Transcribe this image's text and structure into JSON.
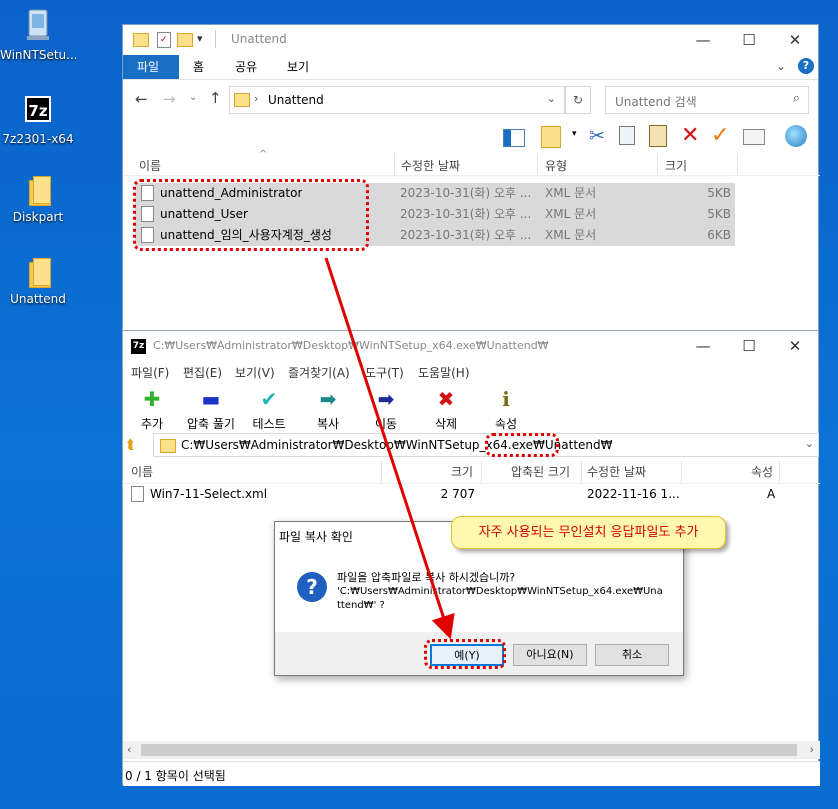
{
  "desktop": {
    "icons": [
      {
        "label": "WinNTSetu..."
      },
      {
        "label": "7z2301-x64"
      },
      {
        "label": "Diskpart"
      },
      {
        "label": "Unattend"
      }
    ]
  },
  "explorer": {
    "title": "Unattend",
    "quick_access_arrow": "▾",
    "ribbon_tabs": [
      "파일",
      "홈",
      "공유",
      "보기"
    ],
    "address": "Unattend",
    "search_placeholder": "Unattend 검색",
    "columns": {
      "name": "이름",
      "date": "수정한 날짜",
      "type": "유형",
      "size": "크기"
    },
    "files": [
      {
        "name": "unattend_Administrator",
        "date": "2023-10-31(화) 오후 ...",
        "type": "XML 문서",
        "size": "5KB"
      },
      {
        "name": "unattend_User",
        "date": "2023-10-31(화) 오후 ...",
        "type": "XML 문서",
        "size": "5KB"
      },
      {
        "name": "unattend_임의_사용자계정_생성",
        "date": "2023-10-31(화) 오후 ...",
        "type": "XML 문서",
        "size": "6KB"
      }
    ]
  },
  "sevenzip": {
    "title": "C:₩Users₩Administrator₩Desktop₩WinNTSetup_x64.exe₩Unattend₩",
    "menu": [
      "파일(F)",
      "편집(E)",
      "보기(V)",
      "즐겨찾기(A)",
      "도구(T)",
      "도움말(H)"
    ],
    "toolbar": [
      "추가",
      "압축 풀기",
      "테스트",
      "복사",
      "이동",
      "삭제",
      "속성"
    ],
    "path": "C:₩Users₩Administrator₩Desktop₩WinNTSetup_x64.exe₩Unattend₩",
    "columns": {
      "name": "이름",
      "size": "크기",
      "packed": "압축된 크기",
      "modified": "수정한 날짜",
      "attr": "속성"
    },
    "files": [
      {
        "name": "Win7-11-Select.xml",
        "size": "2 707",
        "packed": "",
        "modified": "2022-11-16 1...",
        "attr": "A"
      }
    ],
    "status": "0 / 1 항목이 선택됨"
  },
  "dialog": {
    "title": "파일 복사 확인",
    "message_line1": "파일을 압축파일로 복사 하시겠습니까?",
    "message_line2": "'C:₩Users₩Administrator₩Desktop₩WinNTSetup_x64.exe₩Una",
    "message_line3": "ttend₩' ?",
    "yes": "예(Y)",
    "no": "아니요(N)",
    "cancel": "취소"
  },
  "annotation": {
    "text": "자주 사용되는 무인설치 응답파일도 추가"
  },
  "colors": {
    "accent": "#1a6ec4",
    "highlight": "#e00000",
    "note_bg": "#fff9b0"
  }
}
